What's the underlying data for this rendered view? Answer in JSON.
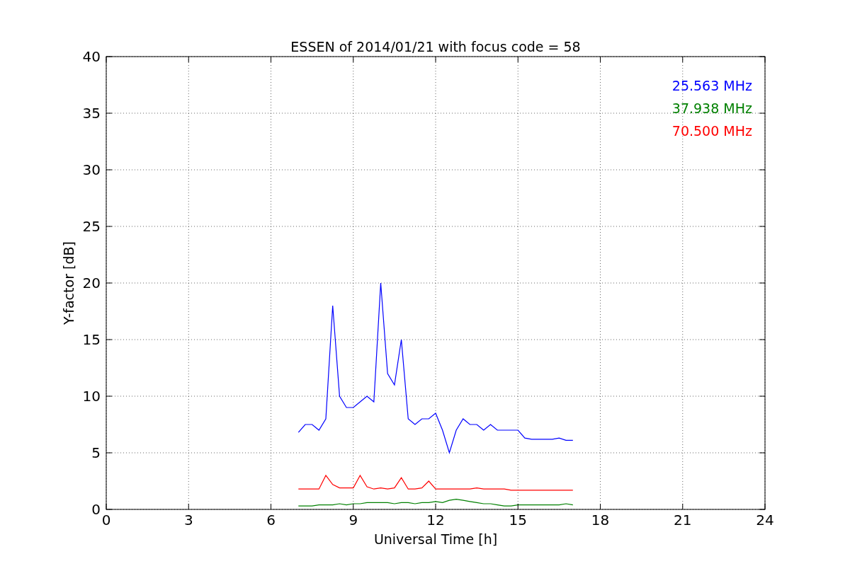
{
  "chart_data": {
    "type": "line",
    "title": "ESSEN of 2014/01/21 with focus code = 58",
    "xlabel": "Universal Time [h]",
    "ylabel": "Y-factor [dB]",
    "x": [
      7,
      7.25,
      7.5,
      7.75,
      8,
      8.25,
      8.5,
      8.75,
      9,
      9.25,
      9.5,
      9.75,
      10,
      10.25,
      10.5,
      10.75,
      11,
      11.25,
      11.5,
      11.75,
      12,
      12.25,
      12.5,
      12.75,
      13,
      13.25,
      13.5,
      13.75,
      14,
      14.25,
      14.5,
      14.75,
      15,
      15.25,
      15.5,
      15.75,
      16,
      16.25,
      16.5,
      16.75,
      17
    ],
    "series": [
      {
        "name": "25.563 MHz",
        "color": "#0000ff",
        "values": [
          6.8,
          7.5,
          7.5,
          7,
          8,
          18,
          10,
          9,
          9,
          9.5,
          10,
          9.5,
          20,
          12,
          11,
          15,
          8,
          7.5,
          8,
          8,
          8.5,
          7,
          5,
          7,
          8,
          7.5,
          7.5,
          7,
          7.5,
          7,
          7,
          7,
          7,
          6.3,
          6.2,
          6.2,
          6.2,
          6.2,
          6.3,
          6.1,
          6.1
        ]
      },
      {
        "name": "37.938 MHz",
        "color": "#008000",
        "values": [
          0.3,
          0.3,
          0.3,
          0.4,
          0.4,
          0.4,
          0.5,
          0.4,
          0.5,
          0.5,
          0.6,
          0.6,
          0.6,
          0.6,
          0.5,
          0.6,
          0.6,
          0.5,
          0.6,
          0.6,
          0.7,
          0.6,
          0.8,
          0.9,
          0.8,
          0.7,
          0.6,
          0.5,
          0.5,
          0.4,
          0.3,
          0.3,
          0.4,
          0.4,
          0.4,
          0.4,
          0.4,
          0.4,
          0.4,
          0.5,
          0.4
        ]
      },
      {
        "name": "70.500 MHz",
        "color": "#ff0000",
        "values": [
          1.8,
          1.8,
          1.8,
          1.8,
          3,
          2.2,
          1.9,
          1.9,
          1.9,
          3,
          2,
          1.8,
          1.9,
          1.8,
          1.9,
          2.8,
          1.8,
          1.8,
          1.9,
          2.5,
          1.8,
          1.8,
          1.8,
          1.8,
          1.8,
          1.8,
          1.9,
          1.8,
          1.8,
          1.8,
          1.8,
          1.7,
          1.7,
          1.7,
          1.7,
          1.7,
          1.7,
          1.7,
          1.7,
          1.7,
          1.7
        ]
      }
    ],
    "xlim": [
      0,
      24
    ],
    "ylim": [
      0,
      40
    ],
    "xticks": [
      0,
      3,
      6,
      9,
      12,
      15,
      18,
      21,
      24
    ],
    "yticks": [
      0,
      5,
      10,
      15,
      20,
      25,
      30,
      35,
      40
    ],
    "grid": true
  }
}
